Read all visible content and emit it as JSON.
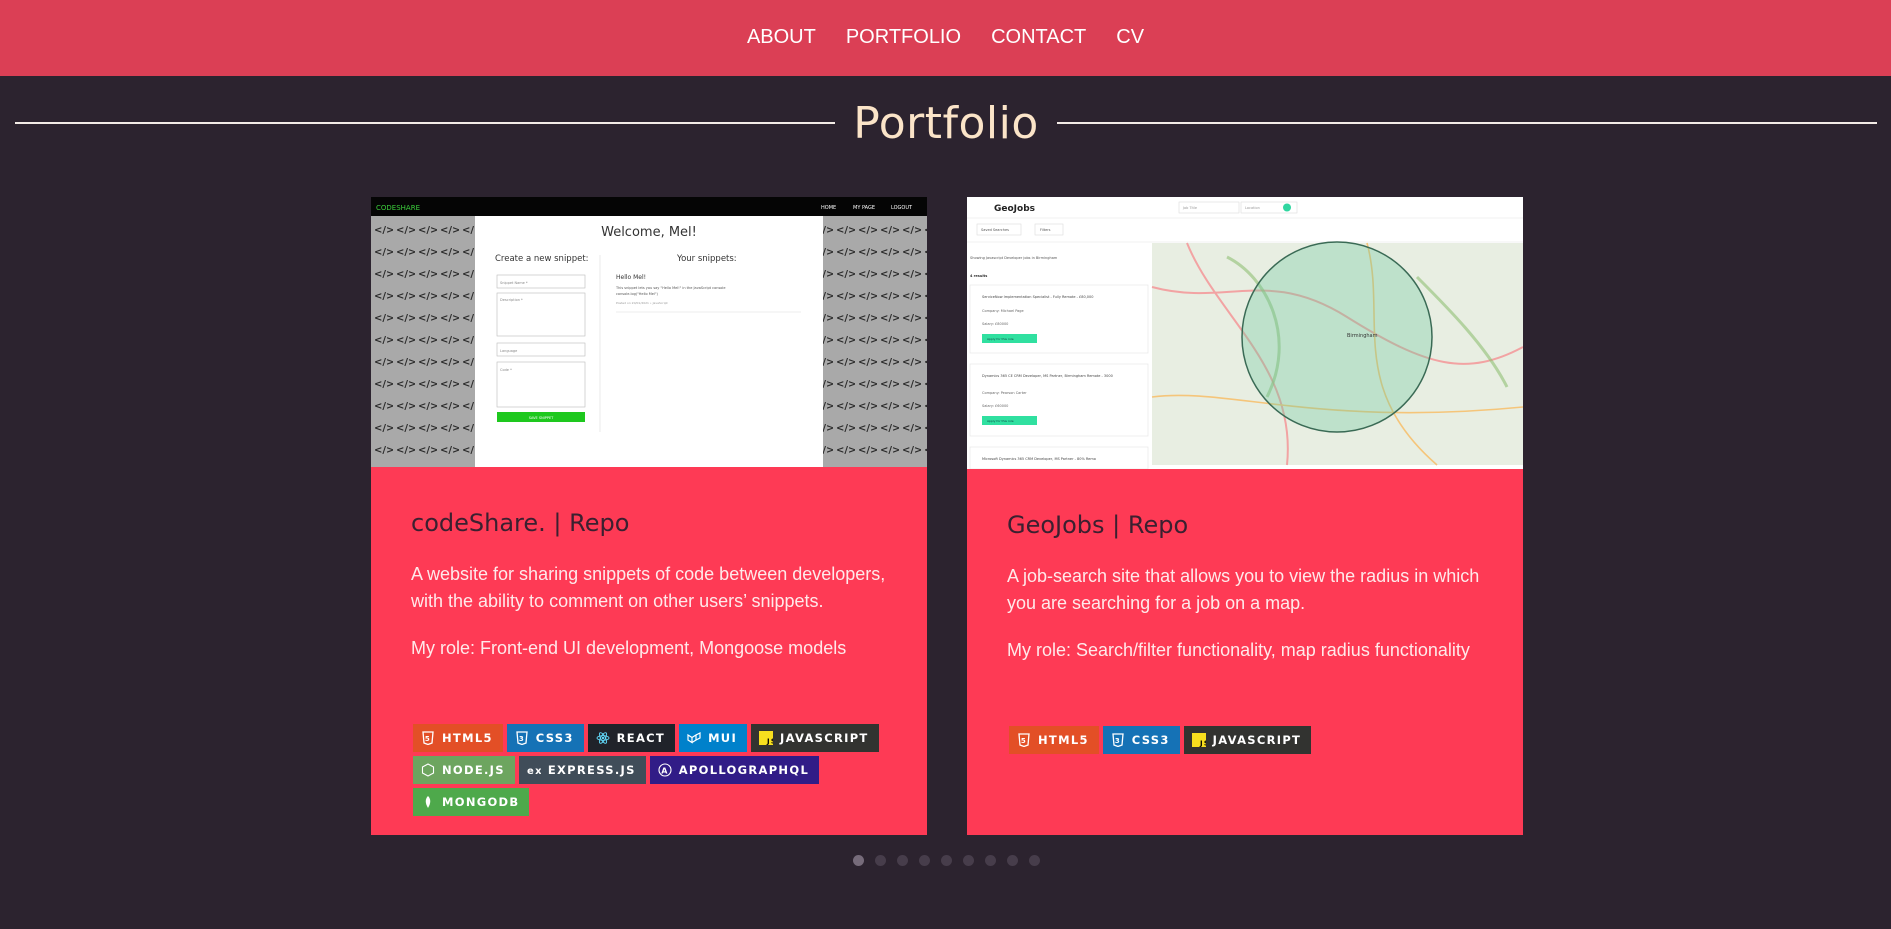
{
  "nav": {
    "items": [
      {
        "label": "ABOUT"
      },
      {
        "label": "PORTFOLIO"
      },
      {
        "label": "CONTACT"
      },
      {
        "label": "CV"
      }
    ]
  },
  "page": {
    "title": "Portfolio"
  },
  "colors": {
    "nav_bg": "#db3f55",
    "page_bg": "#2c232f",
    "card_bg": "#fe3a55",
    "title": "#fbe4c8"
  },
  "projects": [
    {
      "title": "codeShare. | Repo",
      "description": "A website for sharing snippets of code between developers, with the ability to comment on other users’ snippets.",
      "role": "My role: Front-end UI development, Mongoose models",
      "screenshot": {
        "brand": "CODESHARE",
        "nav": [
          "HOME",
          "MY PAGE",
          "LOGOUT"
        ],
        "welcome": "Welcome, Mel!",
        "create_heading": "Create a new snippet:",
        "your_snippets": "Your snippets:",
        "field_name": "Snippet Name *",
        "field_desc": "Description *",
        "field_lang": "Language",
        "field_code": "Code *",
        "save_label": "SAVE SNIPPET",
        "snippet_title": "Hello Mel!",
        "snippet_text": "This snippet lets you say \"Hello Mel!\" in the JavaScript console",
        "snippet_code": "console.log(\"Hello Mel\")",
        "snippet_meta": "Posted on 20/01/2021 • JavaScript"
      },
      "badges": [
        {
          "label": "HTML5",
          "color": "#e34f26",
          "icon": "html5-icon"
        },
        {
          "label": "CSS3",
          "color": "#1572b6",
          "icon": "css3-icon"
        },
        {
          "label": "REACT",
          "color": "#20232a",
          "icon": "react-icon"
        },
        {
          "label": "MUI",
          "color": "#0081cb",
          "icon": "mui-icon"
        },
        {
          "label": "JAVASCRIPT",
          "color": "#323330",
          "icon": "javascript-icon"
        },
        {
          "label": "NODE.JS",
          "color": "#6da55f",
          "icon": "nodejs-icon"
        },
        {
          "label": "EXPRESS.JS",
          "color": "#404d59",
          "icon": "express-icon"
        },
        {
          "label": "APOLLOGRAPHQL",
          "color": "#311c87",
          "icon": "apollo-icon"
        },
        {
          "label": "MONGODB",
          "color": "#4ea94b",
          "icon": "mongodb-icon"
        }
      ]
    },
    {
      "title": "GeoJobs | Repo",
      "description": "A job-search site that allows you to view the radius in which you are searching for a job on a map.",
      "role": "My role: Search/filter functionality, map radius functionality",
      "screenshot": {
        "brand": "GeoJobs",
        "search_placeholder": "Job Title",
        "location_placeholder": "Location",
        "btn_saved": "Saved Searches",
        "btn_filters": "Filters",
        "summary": "Showing Javascript Developer jobs in Birmingham",
        "results": "4 results",
        "jobs": [
          {
            "title": "ServiceNow Implementation Specialist - Fully Remote - £80,000",
            "company": "Company: Michael Page",
            "salary": "Salary: £80000",
            "apply": "Apply for this role"
          },
          {
            "title": "Dynamics 365 CE CRM Developer, MS Partner, Birmingham Remote - 3000",
            "company": "Company: Pearson Carter",
            "salary": "Salary: £60000",
            "apply": "Apply for this role"
          },
          {
            "title": "Microsoft Dynamics 365 CRM Developer, MS Partner - 80% Remo",
            "company": "",
            "salary": "",
            "apply": ""
          }
        ],
        "map_label": "Birmingham"
      },
      "badges": [
        {
          "label": "HTML5",
          "color": "#e34f26",
          "icon": "html5-icon"
        },
        {
          "label": "CSS3",
          "color": "#1572b6",
          "icon": "css3-icon"
        },
        {
          "label": "JAVASCRIPT",
          "color": "#323330",
          "icon": "javascript-icon"
        }
      ]
    }
  ],
  "carousel": {
    "pages": 9,
    "active": 1
  }
}
